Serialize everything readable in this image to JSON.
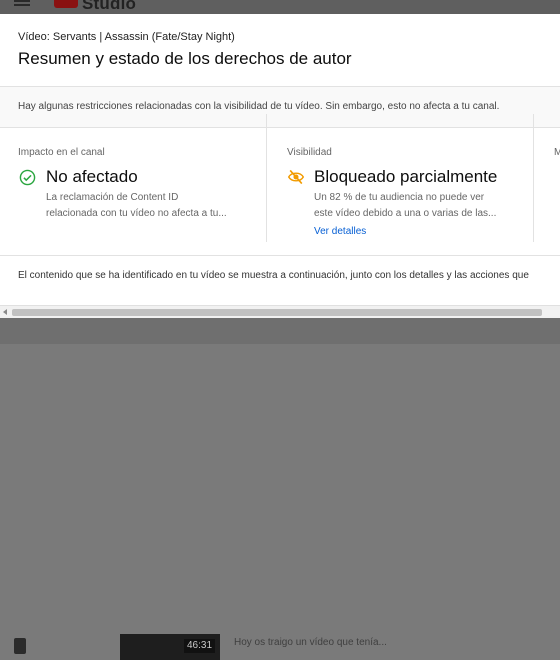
{
  "background": {
    "app_name": "Studio",
    "video_duration": "46:31",
    "video_description": "Hoy os traigo un vídeo que tenía..."
  },
  "dialog": {
    "subtitle": "Vídeo: Servants | Assassin (Fate/Stay Night)",
    "title": "Resumen y estado de los derechos de autor",
    "notice": "Hay algunas restricciones relacionadas con la visibilidad de tu vídeo. Sin embargo, esto no afecta a tu canal.",
    "cards": [
      {
        "label": "Impacto en el canal",
        "status": "No afectado",
        "icon": "check-circle-icon",
        "desc_line1": "La reclamación de Content ID",
        "desc_line2": "relacionada con tu vídeo no afecta a tu..."
      },
      {
        "label": "Visibilidad",
        "status": "Bloqueado parcialmente",
        "icon": "visibility-off-icon",
        "desc_line1": "Un 82 % de tu audiencia no puede ver",
        "desc_line2": "este vídeo debido a una o varias de las...",
        "link": "Ver detalles"
      },
      {
        "label": "M"
      }
    ],
    "footer": "El contenido que se ha identificado en tu vídeo se muestra a continuación, junto con los detalles y las acciones que"
  },
  "colors": {
    "ok_green": "#2ba640",
    "warning_orange": "#f29b00",
    "link_blue": "#065fd4"
  }
}
